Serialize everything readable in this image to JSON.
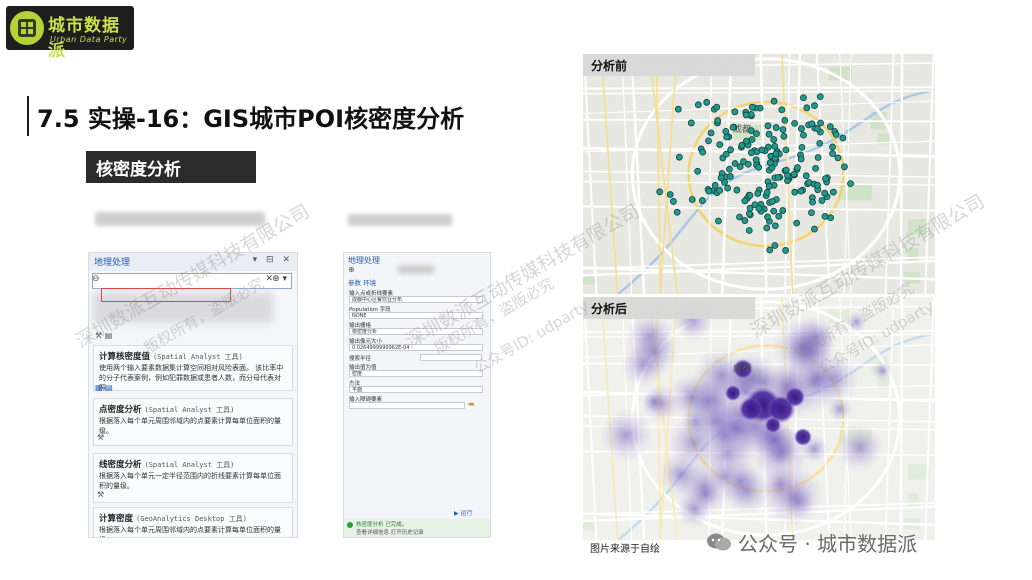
{
  "logo": {
    "title": "城市数据派",
    "subtitle": "Urban Data Party"
  },
  "title": "7.5 实操-16：GIS城市POI核密度分析",
  "section_label": "核密度分析",
  "panel1": {
    "header": "地理处理",
    "controls": "▾ ⊟ ✕",
    "search_clear": "✕",
    "search_dropdown": "⊕ ▾",
    "items": [
      {
        "name": "计算核密度值",
        "tag": "(Spatial Analyst 工具)",
        "desc": "使用两个输入要素数据集计算空间相对风险表面。 该比率中的分子代表案例，例如犯罪数据或患者人数，而分母代表对照…"
      },
      {
        "name": "点密度分析",
        "tag": "(Spatial Analyst 工具)",
        "desc": "根据落入每个单元周围邻域内的点要素计算每单位面积的量级。"
      },
      {
        "name": "线密度分析",
        "tag": "(Spatial Analyst 工具)",
        "desc": "根据落入每个单元一定半径范围内的折线要素计算每单位面积的量级。"
      },
      {
        "name": "计算密度",
        "tag": "(GeoAnalytics Desktop 工具)",
        "desc": "根据落入每个单元周围邻域内的点要素计算每单位面积的量级。"
      }
    ]
  },
  "panel2": {
    "header": "地理处理",
    "back": "⊕",
    "tabs": "参数  环境",
    "fields": [
      {
        "label": "输入点或折线要素",
        "value": "成都中心区餐饮业分布"
      },
      {
        "label": "Population 字段",
        "value": "NONE"
      },
      {
        "label": "输出栅格",
        "value": "核密度分析"
      },
      {
        "label": "输出像元大小",
        "value": "0.0264999999962E-04"
      },
      {
        "label": "搜索半径",
        "value": ""
      },
      {
        "label": "输出值为值",
        "value": "密度"
      },
      {
        "label": "方法",
        "value": "平面"
      },
      {
        "label": "输入障碍要素",
        "value": ""
      }
    ],
    "run_label": "运行",
    "status_line1": "核密度分析 已完成。",
    "status_line2": "查看详细信息  打开历史记录"
  },
  "map_before": {
    "label": "分析前",
    "city_label": "成都"
  },
  "map_after": {
    "label": "分析后",
    "city_label": "成都"
  },
  "credit": "图片来源于自绘",
  "watermarks": {
    "company": "深圳数派互动传媒科技有限公司",
    "rights": "版权所有，盗版必究",
    "account_id": "公众号ID: udparty"
  },
  "wechat_label": "公众号 · 城市数据派",
  "colors": {
    "poi_fill": "#1d9b8e",
    "poi_stroke": "#1a3d3a",
    "density_core": "#3b1880",
    "density_halo": "#b9b0dc",
    "logo_accent": "#c9e04a",
    "section_bg": "#2b2b2b"
  }
}
